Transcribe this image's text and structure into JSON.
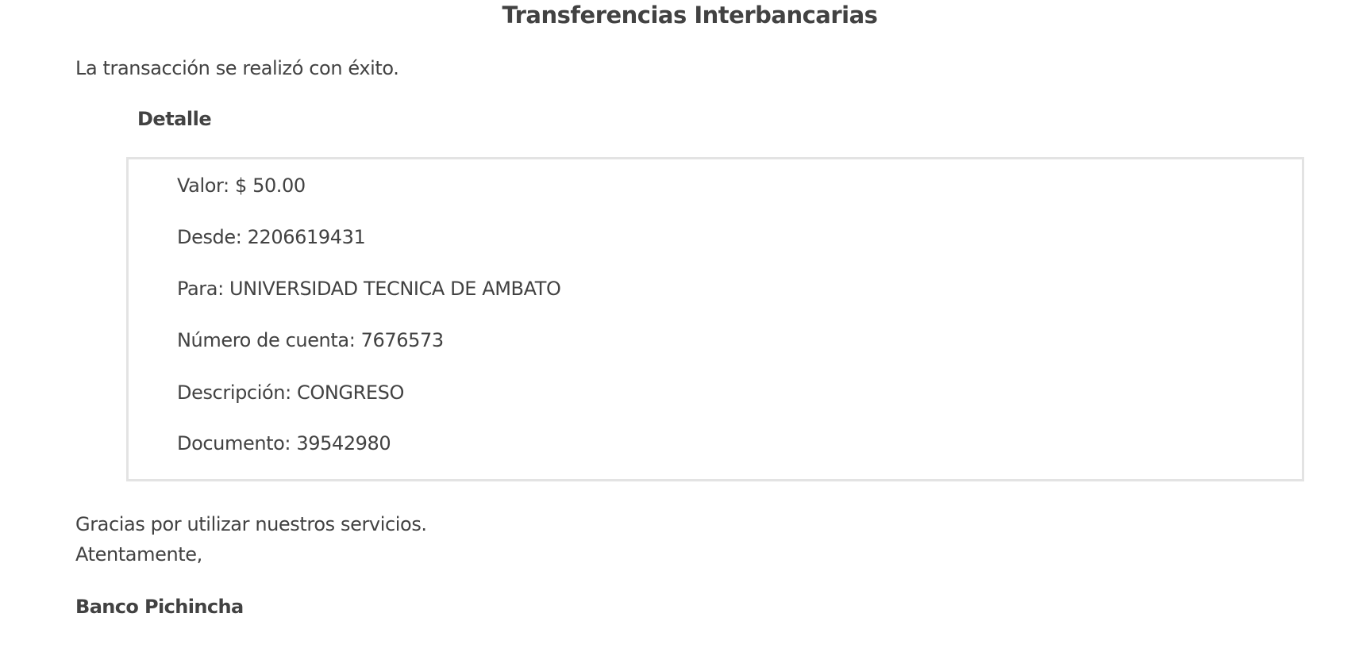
{
  "page": {
    "title": "Transferencias Interbancarias",
    "success_message": "La transacción se realizó con éxito."
  },
  "detail": {
    "heading": "Detalle",
    "rows": [
      "Valor: $ 50.00",
      "Desde: 2206619431",
      "Para: UNIVERSIDAD TECNICA DE AMBATO",
      "Número de cuenta: 7676573",
      "Descripción: CONGRESO",
      "Documento: 39542980"
    ]
  },
  "footer": {
    "thanks": "Gracias por utilizar nuestros servicios.",
    "regards": "Atentamente,",
    "signature": "Banco Pichincha"
  }
}
